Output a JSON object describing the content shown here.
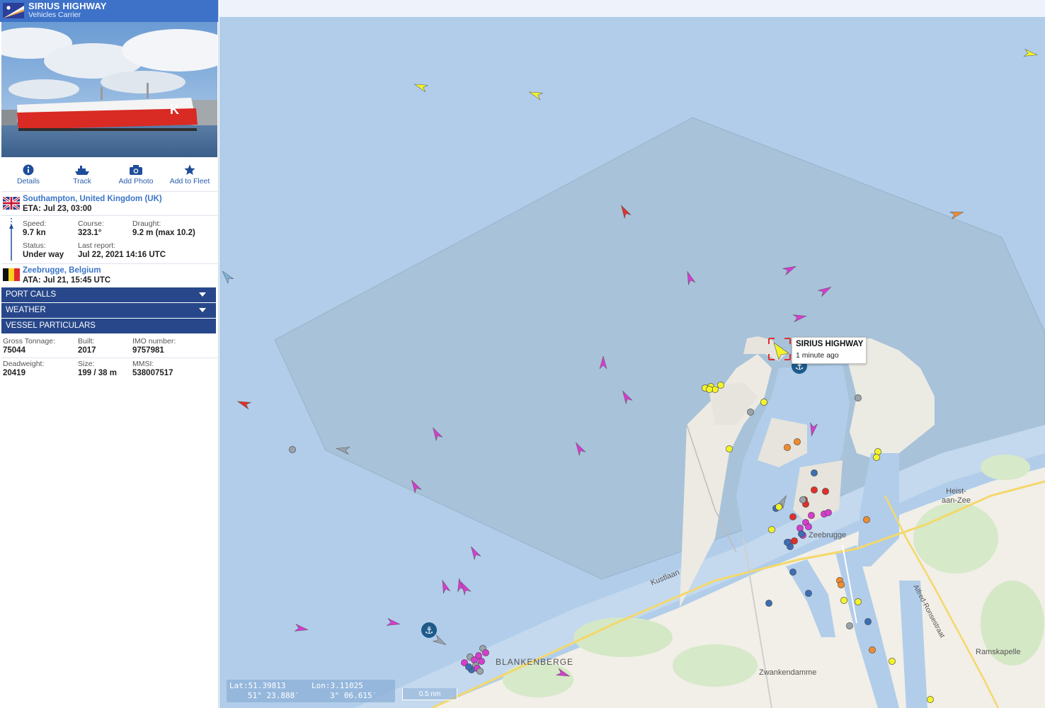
{
  "vessel": {
    "name": "SIRIUS HIGHWAY",
    "type": "Vehicles Carrier",
    "flag": "marshall-islands-flag"
  },
  "toolbar": {
    "details": "Details",
    "track": "Track",
    "add_photo": "Add Photo",
    "add_to_fleet": "Add to Fleet"
  },
  "destination": {
    "port": "Southampton, United Kingdom (UK)",
    "eta": "ETA: Jul 23, 03:00",
    "flag": "uk-flag"
  },
  "voyage": {
    "speed_label": "Speed:",
    "speed": "9.7 kn",
    "course_label": "Course:",
    "course": "323.1°",
    "draught_label": "Draught:",
    "draught": "9.2 m (max 10.2)",
    "status_label": "Status:",
    "status": "Under way",
    "last_report_label": "Last report:",
    "last_report": "Jul 22, 2021 14:16 UTC"
  },
  "departure": {
    "port": "Zeebrugge, Belgium",
    "ata": "ATA: Jul 21, 15:45 UTC",
    "flag": "belgium-flag"
  },
  "sections": {
    "port_calls": "PORT CALLS",
    "weather": "WEATHER",
    "vessel_particulars": "VESSEL PARTICULARS"
  },
  "particulars": {
    "gross_tonnage_label": "Gross Tonnage:",
    "gross_tonnage": "75044",
    "built_label": "Built:",
    "built": "2017",
    "imo_label": "IMO number:",
    "imo": "9757981",
    "deadweight_label": "Deadweight:",
    "deadweight": "20419",
    "size_label": "Size:",
    "size": "199 / 38 m",
    "mmsi_label": "MMSI:",
    "mmsi": "538007517"
  },
  "map": {
    "tooltip_name": "SIRIUS HIGHWAY",
    "tooltip_time": "1 minute ago",
    "lat": "Lat:51.39813",
    "lon": "Lon:3.11025",
    "lat_dms": "51° 23.888′",
    "lon_dms": "3° 06.615′",
    "scale": "0.5 nm",
    "places": {
      "blankenberge": "BLANKENBERGE",
      "zeebrugge": "Zeebrugge",
      "heist": "Heist-\naan-Zee",
      "kustlaan": "Kustlaan",
      "zwankendamme": "Zwankendamme",
      "ramskapelle": "Ramskapelle",
      "alfred": "Alfred-Ronsestraat"
    },
    "colors": {
      "sea": "#b1cdea",
      "land": "#f1efe7",
      "zone": "#a7bfd6",
      "passenger": "#d63ccf",
      "cargo": "#f3f32a",
      "tanker": "#e0302a",
      "tug": "#7fb2d8",
      "other": "#f08c30",
      "sidebar_header": "#3e72c9",
      "section_bar": "#27478a"
    }
  }
}
